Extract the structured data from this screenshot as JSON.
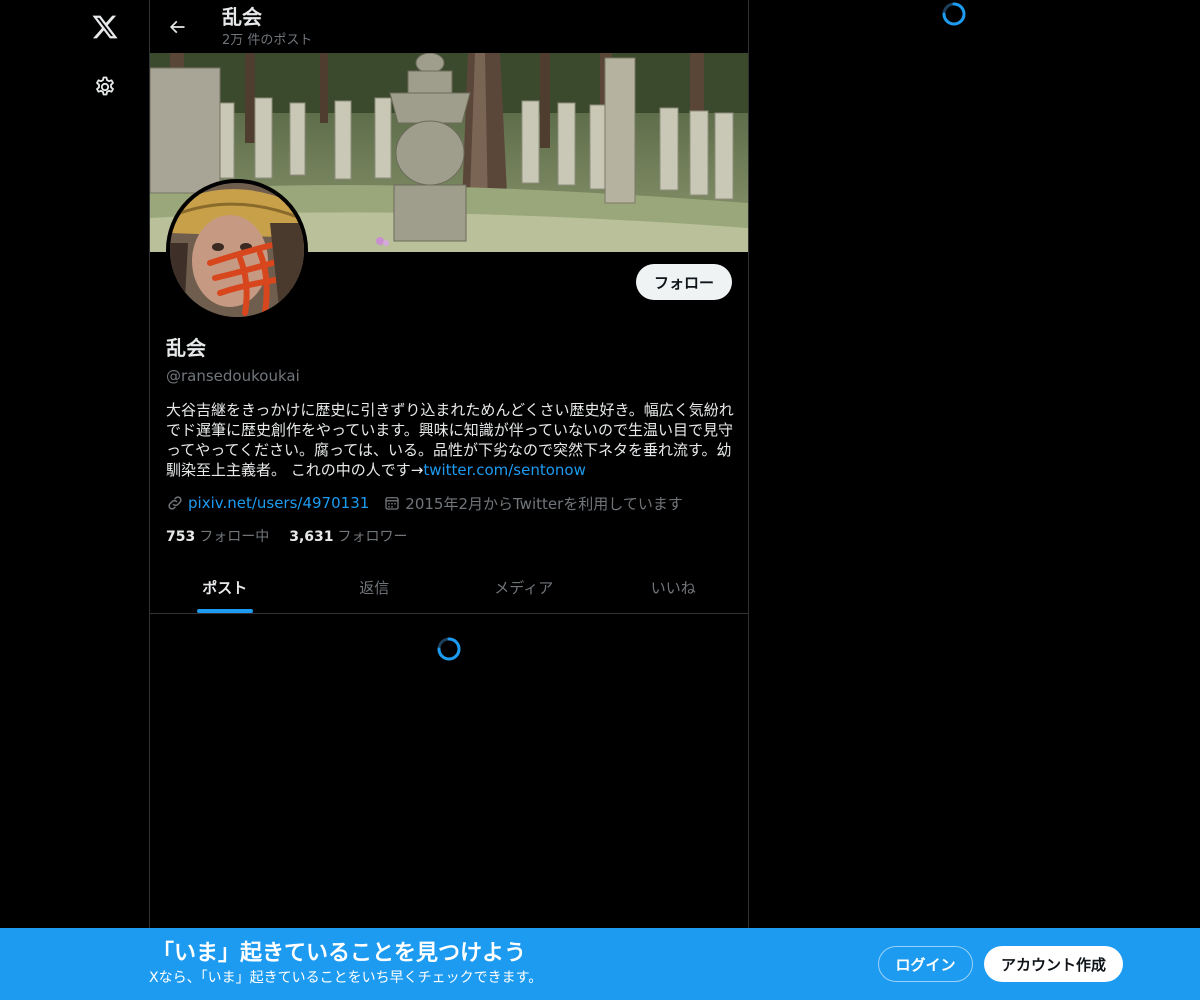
{
  "nav": {
    "logo_icon": "x-logo-icon",
    "settings_icon": "gear-icon"
  },
  "header": {
    "title": "乱会",
    "post_count": "2万 件のポスト",
    "back_icon": "arrow-left-icon"
  },
  "profile": {
    "display_name": "乱会",
    "handle": "@ransedoukoukai",
    "follow_label": "フォロー",
    "bio_text": "大谷吉継をきっかけに歴史に引きずり込まれためんどくさい歴史好き。幅広く気紛れでド遅筆に歴史創作をやっています。興味に知識が伴っていないので生温い目で見守ってやってください。腐っては、いる。品性が下劣なので突然下ネタを垂れ流す。幼馴染至上主義者。 これの中の人です→",
    "bio_link": "twitter.com/sentonow",
    "website": "pixiv.net/users/4970131",
    "joined": "2015年2月からTwitterを利用しています",
    "following_count": "753",
    "following_label": "フォロー中",
    "followers_count": "3,631",
    "followers_label": "フォロワー"
  },
  "tabs": [
    {
      "label": "ポスト",
      "active": true
    },
    {
      "label": "返信",
      "active": false
    },
    {
      "label": "メディア",
      "active": false
    },
    {
      "label": "いいね",
      "active": false
    }
  ],
  "login_banner": {
    "title": "「いま」起きていることを見つけよう",
    "subtitle": "Xなら、「いま」起きていることをいち早くチェックできます。",
    "login_label": "ログイン",
    "signup_label": "アカウント作成"
  },
  "colors": {
    "accent": "#1d9bf0",
    "background": "#000000",
    "text_primary": "#e7e9ea",
    "text_secondary": "#71767b",
    "border": "#2f3336"
  }
}
